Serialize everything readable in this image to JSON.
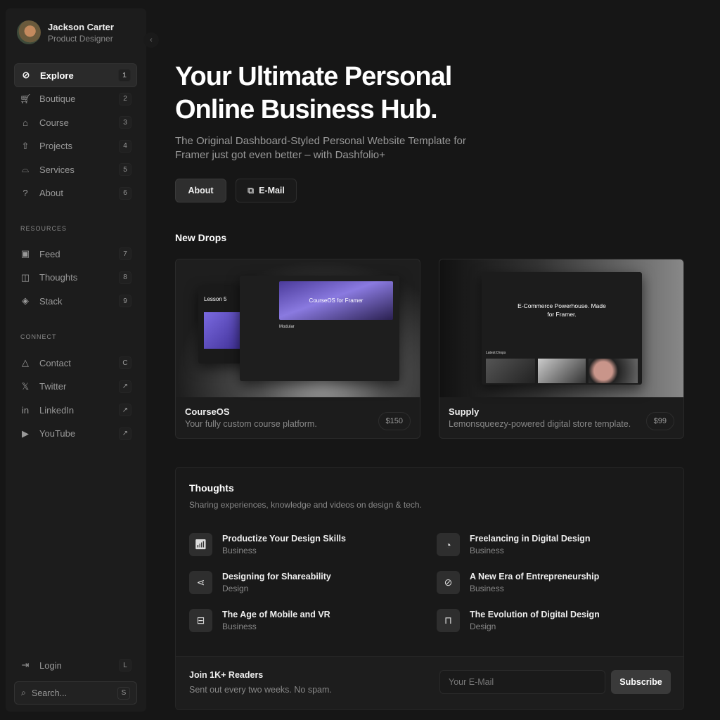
{
  "profile": {
    "name": "Jackson Carter",
    "role": "Product Designer"
  },
  "nav": [
    {
      "label": "Explore",
      "key": "1",
      "icon": "compass-icon",
      "glyph": "⊘"
    },
    {
      "label": "Boutique",
      "key": "2",
      "icon": "cart-icon",
      "glyph": "🛒︎"
    },
    {
      "label": "Course",
      "key": "3",
      "icon": "graduation-cap-icon",
      "glyph": "⌂"
    },
    {
      "label": "Projects",
      "key": "4",
      "icon": "projects-icon",
      "glyph": "⇧"
    },
    {
      "label": "Services",
      "key": "5",
      "icon": "bell-service-icon",
      "glyph": "⌓"
    },
    {
      "label": "About",
      "key": "6",
      "icon": "about-icon",
      "glyph": "?"
    }
  ],
  "resources_label": "RESOURCES",
  "resources": [
    {
      "label": "Feed",
      "key": "7",
      "glyph": "▣"
    },
    {
      "label": "Thoughts",
      "key": "8",
      "glyph": "◫"
    },
    {
      "label": "Stack",
      "key": "9",
      "glyph": "◈"
    }
  ],
  "connect_label": "CONNECT",
  "connect": [
    {
      "label": "Contact",
      "key": "C",
      "glyph": "△"
    },
    {
      "label": "Twitter",
      "key": "↗",
      "glyph": "𝕏"
    },
    {
      "label": "LinkedIn",
      "key": "↗",
      "glyph": "in"
    },
    {
      "label": "YouTube",
      "key": "↗",
      "glyph": "▶"
    }
  ],
  "login": {
    "label": "Login",
    "key": "L"
  },
  "search": {
    "placeholder": "Search...",
    "key": "S"
  },
  "hero": {
    "title": "Your Ultimate Personal Online Business Hub.",
    "subtitle": "The Original Dashboard-Styled Personal Website Template for Framer just got even better – with Dashfolio+",
    "about_label": "About",
    "email_label": "E-Mail"
  },
  "drops": {
    "heading": "New Drops",
    "items": [
      {
        "title": "CourseOS",
        "desc": "Your fully custom course platform.",
        "price": "$150",
        "preview": {
          "lesson": "Lesson 5",
          "banner": "CourseOS for Framer",
          "section": "Modular"
        }
      },
      {
        "title": "Supply",
        "desc": "Lemonsqueezy-powered digital store template.",
        "price": "$99",
        "preview": {
          "headline": "E-Commerce Powerhouse. Made for Framer.",
          "section": "Latest Drops"
        }
      }
    ]
  },
  "thoughts": {
    "heading": "Thoughts",
    "subtitle": "Sharing experiences, knowledge and videos on design & tech.",
    "items": [
      {
        "title": "Productize Your Design Skills",
        "category": "Business",
        "glyph": "📶︎"
      },
      {
        "title": "Freelancing in Digital Design",
        "category": "Business",
        "glyph": "◔"
      },
      {
        "title": "Designing for Shareability",
        "category": "Design",
        "glyph": "⋖"
      },
      {
        "title": "A New Era of Entrepreneurship",
        "category": "Business",
        "glyph": "⊘"
      },
      {
        "title": "The Age of Mobile and VR",
        "category": "Business",
        "glyph": "⊟"
      },
      {
        "title": "The Evolution of Digital Design",
        "category": "Design",
        "glyph": "⊓"
      }
    ]
  },
  "newsletter": {
    "title": "Join 1K+ Readers",
    "subtitle": "Sent out every two weeks. No spam.",
    "placeholder": "Your E-Mail",
    "button": "Subscribe"
  }
}
